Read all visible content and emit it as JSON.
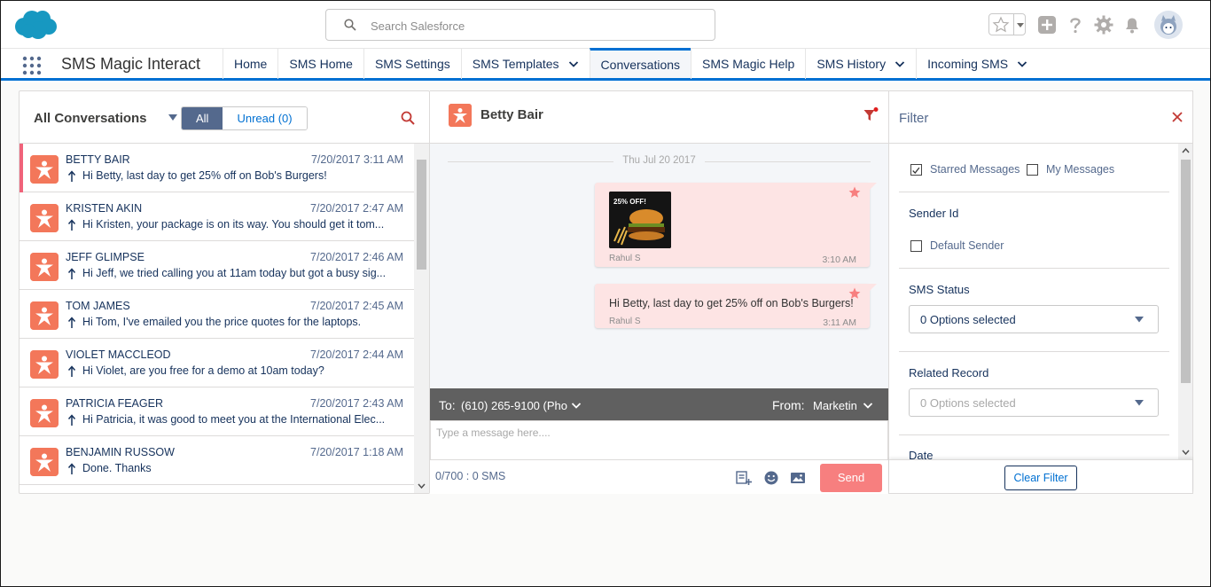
{
  "search": {
    "placeholder": "Search Salesforce"
  },
  "app": {
    "name": "SMS Magic Interact"
  },
  "nav": {
    "items": [
      {
        "label": "Home",
        "has_menu": false
      },
      {
        "label": "SMS Home",
        "has_menu": false
      },
      {
        "label": "SMS Settings",
        "has_menu": false
      },
      {
        "label": "SMS Templates",
        "has_menu": true
      },
      {
        "label": "Conversations",
        "has_menu": false,
        "active": true
      },
      {
        "label": "SMS Magic Help",
        "has_menu": false
      },
      {
        "label": "SMS History",
        "has_menu": true
      },
      {
        "label": "Incoming SMS",
        "has_menu": true
      }
    ]
  },
  "conversations": {
    "title": "All Conversations",
    "filter_all": "All",
    "filter_unread": "Unread (0)",
    "items": [
      {
        "name": "BETTY BAIR",
        "time": "7/20/2017 3:11 AM",
        "preview": "Hi Betty, last day to get 25% off on Bob's Burgers!"
      },
      {
        "name": "KRISTEN AKIN",
        "time": "7/20/2017 2:47 AM",
        "preview": "Hi Kristen, your package is on its way. You should get it tom..."
      },
      {
        "name": "JEFF GLIMPSE",
        "time": "7/20/2017 2:46 AM",
        "preview": "Hi Jeff, we tried calling you at 11am today but got a busy sig..."
      },
      {
        "name": "TOM JAMES",
        "time": "7/20/2017 2:45 AM",
        "preview": "Hi Tom, I've emailed you the price quotes for the laptops."
      },
      {
        "name": "VIOLET MACCLEOD",
        "time": "7/20/2017 2:44 AM",
        "preview": "Hi Violet, are you free for a demo at 10am today?"
      },
      {
        "name": "PATRICIA FEAGER",
        "time": "7/20/2017 2:43 AM",
        "preview": "Hi Patricia, it was good to meet you at the International Elec..."
      },
      {
        "name": "BENJAMIN RUSSOW",
        "time": "7/20/2017 1:18 AM",
        "preview": "Done. Thanks"
      }
    ]
  },
  "chat": {
    "contact_name": "Betty Bair",
    "date_separator": "Thu Jul 20 2017",
    "messages": [
      {
        "type": "image",
        "image_text": "25% OFF!",
        "sender": "Rahul S",
        "time": "3:10 AM",
        "starred": true
      },
      {
        "type": "text",
        "text": "Hi Betty, last day to get 25% off on Bob's Burgers!",
        "sender": "Rahul S",
        "time": "3:11 AM",
        "starred": true
      }
    ],
    "to_label": "To:",
    "to_value": "(610) 265-9100 (Pho",
    "from_label": "From:",
    "from_value": "Marketin",
    "message_placeholder": "Type a message here....",
    "sms_counter": "0/700 : 0 SMS",
    "send_label": "Send"
  },
  "filter": {
    "title": "Filter",
    "starred_label": "Starred Messages",
    "starred_checked": true,
    "my_messages_label": "My Messages",
    "my_messages_checked": false,
    "sender_id_title": "Sender Id",
    "default_sender_label": "Default Sender",
    "sms_status_title": "SMS Status",
    "sms_status_value": "0 Options selected",
    "related_record_title": "Related Record",
    "related_record_value": "0 Options selected",
    "date_title": "Date",
    "clear_label": "Clear Filter"
  },
  "colors": {
    "accent": "#0070d2",
    "avatar_orange": "#f3775a",
    "bubble_pink": "#fde4e4",
    "send_button": "#f77f7f",
    "selected_marker": "#f0637a"
  }
}
